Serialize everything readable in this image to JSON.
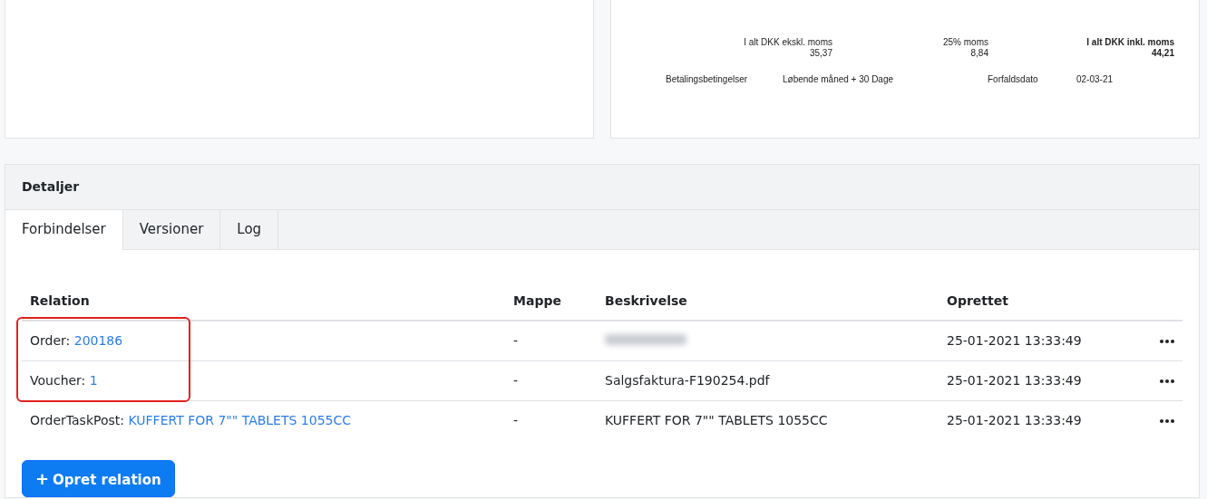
{
  "invoice_summary": {
    "totals": [
      {
        "label": "I alt DKK ekskl. moms",
        "value": "35,37",
        "emphasis": false
      },
      {
        "label": "25% moms",
        "value": "8,84",
        "emphasis": false
      },
      {
        "label": "I alt DKK inkl. moms",
        "value": "44,21",
        "emphasis": true
      }
    ],
    "terms": [
      {
        "label": "Betalingsbetingelser",
        "value": "Løbende måned + 30 Dage"
      },
      {
        "label": "Forfaldsdato",
        "value": "02-03-21"
      }
    ]
  },
  "details": {
    "title": "Detaljer",
    "tabs": [
      {
        "label": "Forbindelser",
        "selected": true
      },
      {
        "label": "Versioner",
        "selected": false
      },
      {
        "label": "Log",
        "selected": false
      }
    ],
    "table": {
      "columns": [
        "Relation",
        "Mappe",
        "Beskrivelse",
        "Oprettet"
      ],
      "rows": [
        {
          "relation_type": "Order:",
          "relation_link": "200186",
          "folder": "-",
          "description": {
            "kind": "redacted"
          },
          "created": "25-01-2021 13:33:49",
          "highlighted": true
        },
        {
          "relation_type": "Voucher:",
          "relation_link": "1",
          "folder": "-",
          "description": {
            "kind": "text",
            "text": "Salgsfaktura-F190254.pdf"
          },
          "created": "25-01-2021 13:33:49",
          "highlighted": true
        },
        {
          "relation_type": "OrderTaskPost:",
          "relation_link": "KUFFERT FOR 7\"\" TABLETS 1055CC",
          "folder": "-",
          "description": {
            "kind": "text",
            "text": "KUFFERT FOR 7\"\" TABLETS 1055CC"
          },
          "created": "25-01-2021 13:33:49",
          "highlighted": false
        }
      ]
    },
    "button": {
      "icon": "+",
      "label": "Opret relation"
    }
  }
}
